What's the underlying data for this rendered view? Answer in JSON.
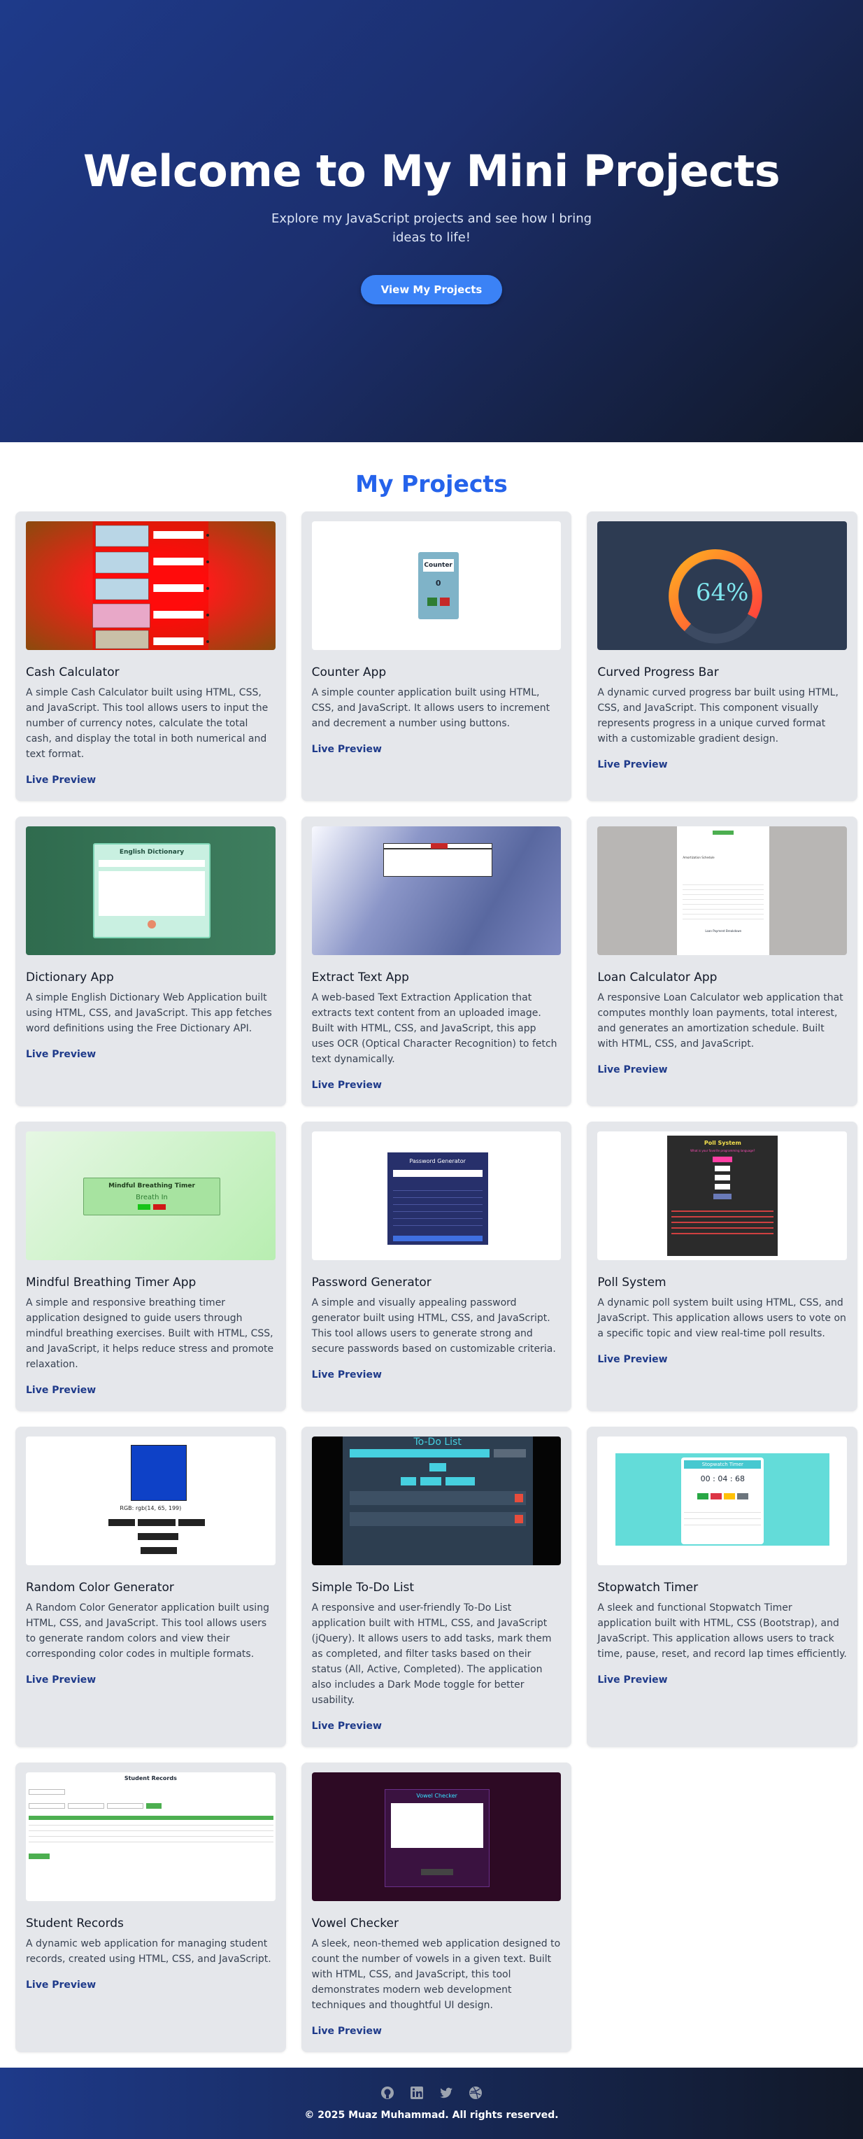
{
  "hero": {
    "title": "Welcome to My Mini Projects",
    "subtitle": "Explore my JavaScript projects and see how I bring ideas to life!",
    "button_label": "View My Projects"
  },
  "projects": {
    "heading": "My Projects",
    "link_label": "Live Preview",
    "items": [
      {
        "title": "Cash Calculator",
        "description": "A simple Cash Calculator built using HTML, CSS, and JavaScript. This tool allows users to input the number of currency notes, calculate the total cash, and display the total in both numerical and text format."
      },
      {
        "title": "Counter App",
        "description": "A simple counter application built using HTML, CSS, and JavaScript. It allows users to increment and decrement a number using buttons."
      },
      {
        "title": "Curved Progress Bar",
        "description": "A dynamic curved progress bar built using HTML, CSS, and JavaScript. This component visually represents progress in a unique curved format with a customizable gradient design."
      },
      {
        "title": "Dictionary App",
        "description": "A simple English Dictionary Web Application built using HTML, CSS, and JavaScript. This app fetches word definitions using the Free Dictionary API."
      },
      {
        "title": "Extract Text App",
        "description": "A web-based Text Extraction Application that extracts text content from an uploaded image. Built with HTML, CSS, and JavaScript, this app uses OCR (Optical Character Recognition) to fetch text dynamically."
      },
      {
        "title": "Loan Calculator App",
        "description": "A responsive Loan Calculator web application that computes monthly loan payments, total interest, and generates an amortization schedule. Built with HTML, CSS, and JavaScript."
      },
      {
        "title": "Mindful Breathing Timer App",
        "description": "A simple and responsive breathing timer application designed to guide users through mindful breathing exercises. Built with HTML, CSS, and JavaScript, it helps reduce stress and promote relaxation."
      },
      {
        "title": "Password Generator",
        "description": "A simple and visually appealing password generator built using HTML, CSS, and JavaScript. This tool allows users to generate strong and secure passwords based on customizable criteria."
      },
      {
        "title": "Poll System",
        "description": "A dynamic poll system built using HTML, CSS, and JavaScript. This application allows users to vote on a specific topic and view real-time poll results."
      },
      {
        "title": "Random Color Generator",
        "description": "A Random Color Generator application built using HTML, CSS, and JavaScript. This tool allows users to generate random colors and view their corresponding color codes in multiple formats."
      },
      {
        "title": "Simple To-Do List",
        "description": "A responsive and user-friendly To-Do List application built with HTML, CSS, and JavaScript (jQuery). It allows users to add tasks, mark them as completed, and filter tasks based on their status (All, Active, Completed). The application also includes a Dark Mode toggle for better usability."
      },
      {
        "title": "Stopwatch Timer",
        "description": "A sleek and functional Stopwatch Timer application built with HTML, CSS (Bootstrap), and JavaScript. This application allows users to track time, pause, reset, and record lap times efficiently."
      },
      {
        "title": "Student Records",
        "description": "A dynamic web application for managing student records, created using HTML, CSS, and JavaScript."
      },
      {
        "title": "Vowel Checker",
        "description": "A sleek, neon-themed web application designed to count the number of vowels in a given text. Built with HTML, CSS, and JavaScript, this tool demonstrates modern web development techniques and thoughtful UI design."
      }
    ],
    "thumbnails": {
      "counter_title": "Counter",
      "counter_value": "0",
      "progress_value": "64%",
      "dictionary_title": "English Dictionary",
      "breath_title": "Mindful Breathing Timer",
      "breath_state": "Breath In",
      "password_title": "Password Generator",
      "poll_title": "Poll System",
      "poll_question": "What is your favorite programming language?",
      "color_code": "RGB: rgb(14, 65, 199)",
      "todo_title": "To-Do List",
      "stopwatch_title": "Stopwatch Timer",
      "stopwatch_time": "00 : 04 : 68",
      "records_title": "Student Records",
      "vowel_title": "Vowel Checker",
      "loan_caption": "Loan Payment Breakdown",
      "amortization_caption": "Amortization Schedule"
    }
  },
  "footer": {
    "copyright": "© 2025 Muaz Muhammad. All rights reserved.",
    "icons": [
      "github-icon",
      "linkedin-icon",
      "twitter-icon",
      "dribbble-icon"
    ]
  },
  "colors": {
    "hero_start": "#1e3a8a",
    "hero_end": "#111827",
    "accent": "#3b82f6",
    "heading": "#2563eb",
    "card_bg": "#e5e7eb",
    "link": "#1e3a8a"
  }
}
